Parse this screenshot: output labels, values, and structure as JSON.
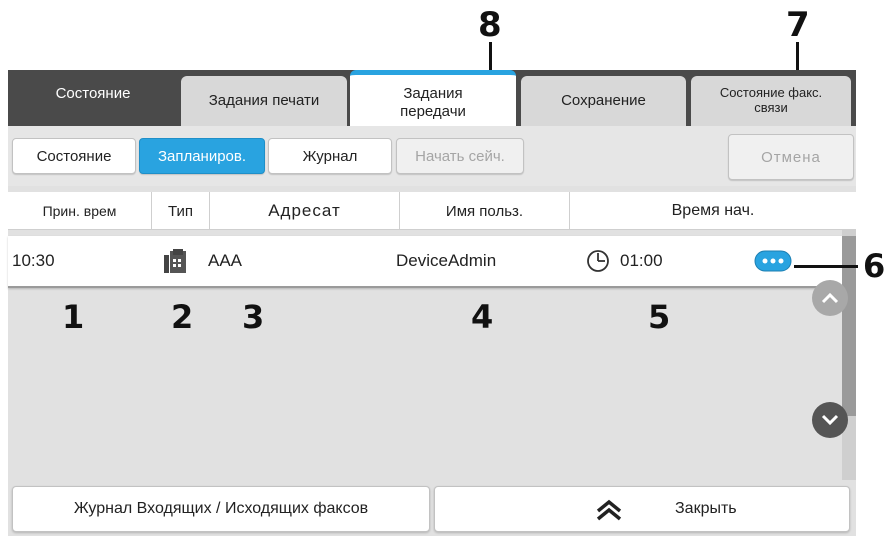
{
  "callouts": {
    "c1": "1",
    "c2": "2",
    "c3": "3",
    "c4": "4",
    "c5": "5",
    "c6": "6",
    "c7": "7",
    "c8": "8"
  },
  "tabs": {
    "status": "Состояние",
    "print_jobs": "Задания печати",
    "send_jobs_line1": "Задания",
    "send_jobs_line2": "передачи",
    "storage": "Сохранение",
    "fax_status_line1": "Состояние факс.",
    "fax_status_line2": "связи"
  },
  "subtabs": {
    "status": "Состояние",
    "scheduled": "Запланиров.",
    "log": "Журнал",
    "start_now": "Начать сейч.",
    "cancel": "Отмена"
  },
  "columns": {
    "accepted_time": "Прин. врем",
    "type": "Тип",
    "destination": "Адресат",
    "user_name": "Имя польз.",
    "start_time": "Время нач."
  },
  "jobs": [
    {
      "accepted_time": "10:30",
      "type_icon": "fax-icon",
      "destination": "AAA",
      "user_name": "DeviceAdmin",
      "start_time_icon": "clock-icon",
      "start_time": "01:00",
      "details_icon": "more-icon"
    }
  ],
  "footer": {
    "fax_log": "Журнал Входящих / Исходящих факсов",
    "close": "Закрыть",
    "close_icon": "double-chevron-up-icon"
  },
  "colors": {
    "accent": "#29a3e0",
    "tab_bar": "#4a4a4a",
    "panel": "#e1e1e1"
  }
}
